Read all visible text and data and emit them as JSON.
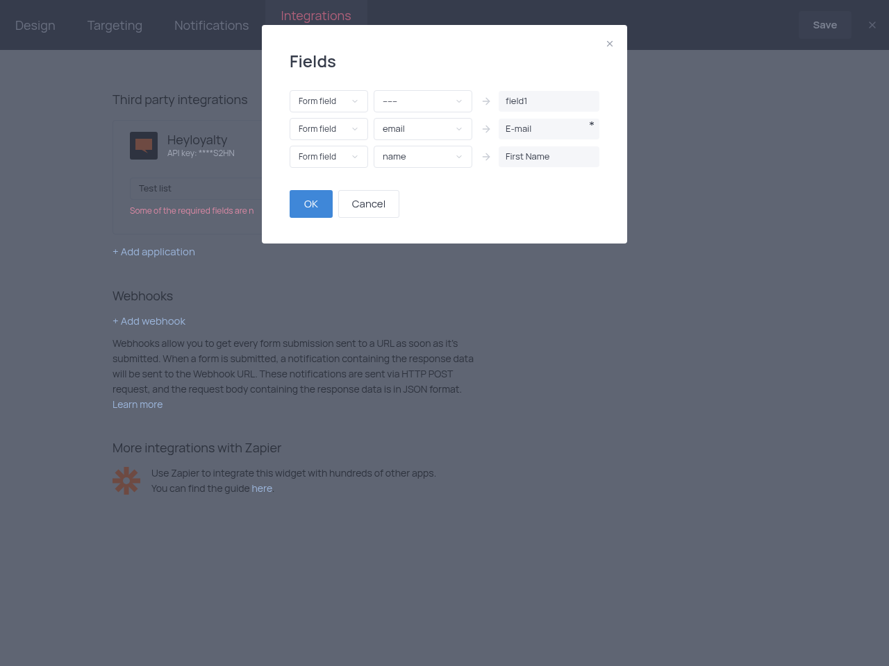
{
  "nav": {
    "tabs": [
      {
        "label": "Design",
        "selected": false
      },
      {
        "label": "Targeting",
        "selected": false
      },
      {
        "label": "Notifications",
        "selected": false
      },
      {
        "label": "Integrations",
        "selected": true
      }
    ],
    "save": "Save"
  },
  "third_party": {
    "title": "Third party integrations",
    "app": {
      "name": "Heyloyalty",
      "api_key": "API key: ****S2HN",
      "list": "Test list",
      "error": "Some of the required fields are n"
    },
    "add": "+ Add application"
  },
  "webhooks": {
    "title": "Webhooks",
    "add": "+ Add webhook",
    "text": "Webhooks allow you to get every form submission sent to a URL as soon as it's submitted. When a form is submitted, a notification containing the response data will be sent to the Webhook URL. These notifications are sent via HTTP POST request, and the request body containing the response data is in JSON format.",
    "link": "Learn more"
  },
  "zapier": {
    "title": "More integrations with Zapier",
    "line1": "Use Zapier to integrate this widget with hundreds of other apps.",
    "line2": "You can find the guide",
    "link": "here",
    "after": "."
  },
  "dialog": {
    "title": "Fields",
    "rows": [
      {
        "source": "Form field",
        "field": "–––",
        "target": "field1",
        "required": false
      },
      {
        "source": "Form field",
        "field": "email",
        "target": "E-mail",
        "required": true
      },
      {
        "source": "Form field",
        "field": "name",
        "target": "First Name",
        "required": false
      }
    ],
    "ok": "OK",
    "cancel": "Cancel"
  }
}
